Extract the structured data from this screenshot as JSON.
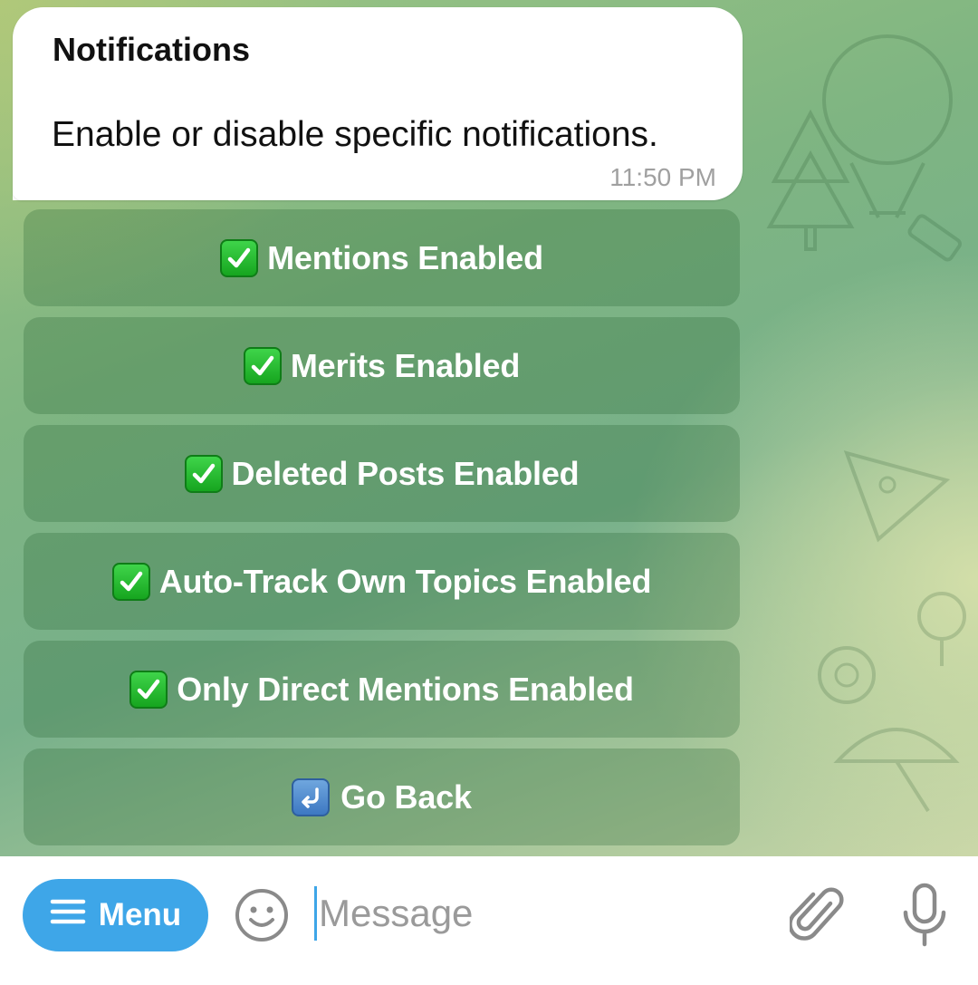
{
  "message": {
    "title": "Notifications",
    "text": "Enable or disable specific notifications.",
    "time": "11:50 PM"
  },
  "keyboard": {
    "buttons": [
      {
        "emoji": "check-mark-button",
        "label": "Mentions Enabled"
      },
      {
        "emoji": "check-mark-button",
        "label": "Merits Enabled"
      },
      {
        "emoji": "check-mark-button",
        "label": "Deleted Posts Enabled"
      },
      {
        "emoji": "check-mark-button",
        "label": "Auto-Track Own Topics Enabled"
      },
      {
        "emoji": "check-mark-button",
        "label": "Only Direct Mentions Enabled"
      },
      {
        "emoji": "return-arrow",
        "label": "Go Back"
      }
    ]
  },
  "input_bar": {
    "menu_label": "Menu",
    "placeholder": "Message",
    "value": ""
  },
  "colors": {
    "accent": "#3ea6e8",
    "check_green": "#16a51f",
    "bubble_bg": "#ffffff"
  },
  "icons": [
    "menu-icon",
    "emoji-icon",
    "paperclip-icon",
    "microphone-icon"
  ]
}
